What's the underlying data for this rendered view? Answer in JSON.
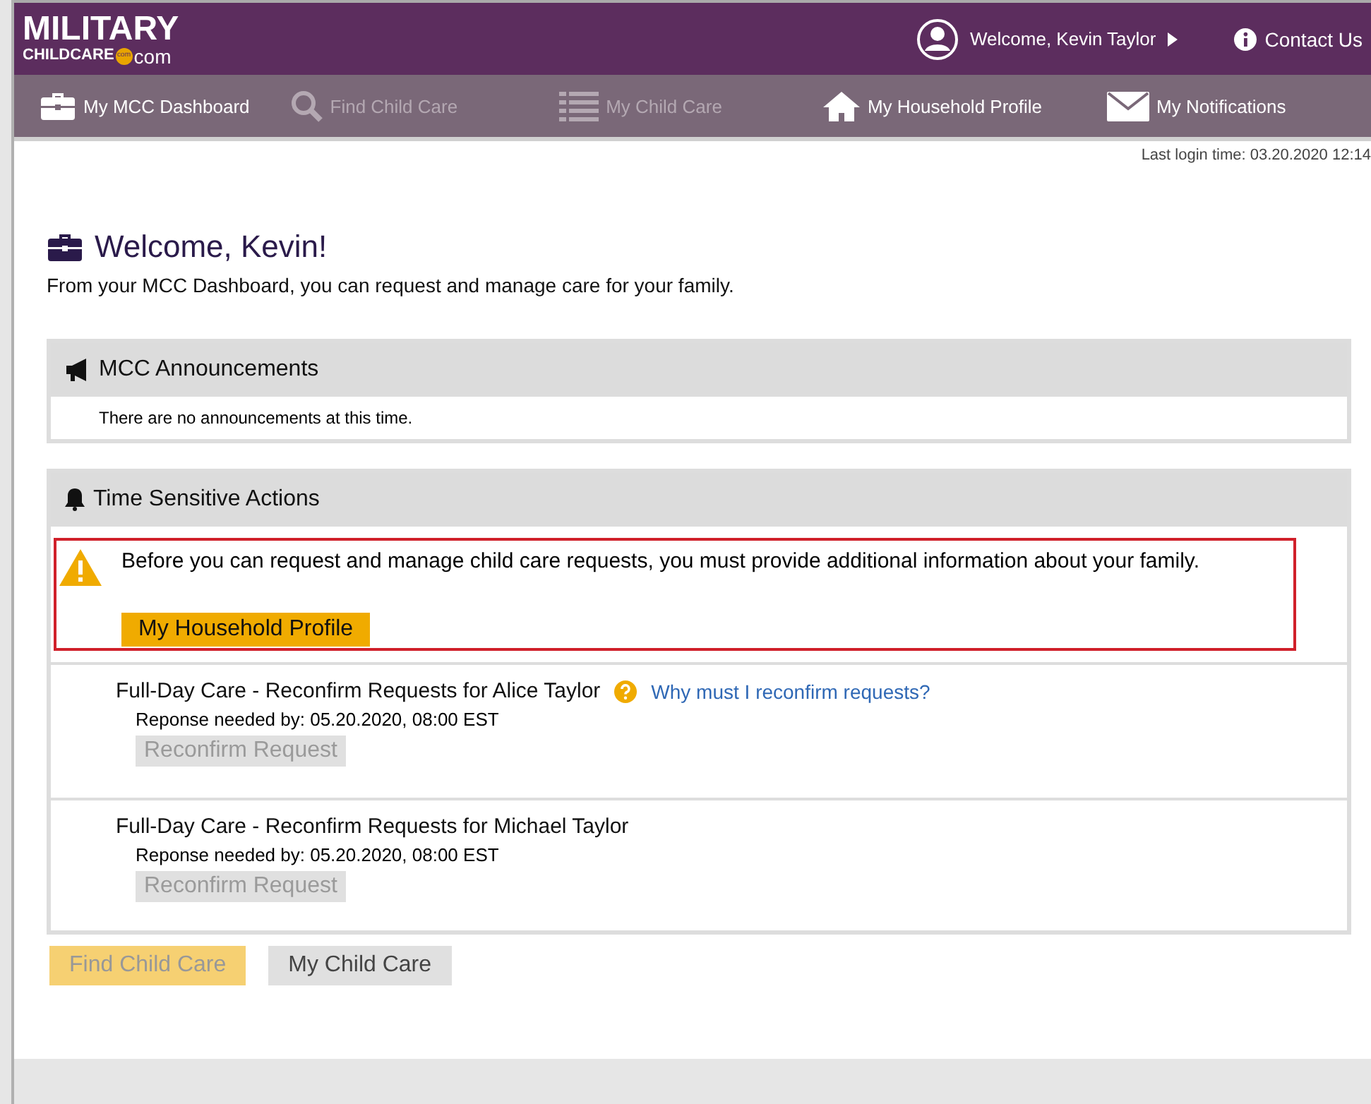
{
  "header": {
    "logo_top": "MILITARY",
    "logo_bottom": "CHILDCARE",
    "logo_badge": "com",
    "logo_suffix": "com",
    "user": "Welcome, Kevin Taylor",
    "contact": "Contact Us"
  },
  "nav": [
    {
      "label": "My MCC Dashboard",
      "kind": "briefcase",
      "disabled": false
    },
    {
      "label": "Find Child Care",
      "kind": "search",
      "disabled": true
    },
    {
      "label": "My Child Care",
      "kind": "list",
      "disabled": true
    },
    {
      "label": "My Household Profile",
      "kind": "home",
      "disabled": false
    },
    {
      "label": "My Notifications",
      "kind": "mail",
      "disabled": false
    }
  ],
  "last_login": "Last login time: 03.20.2020 12:14",
  "title": "Welcome, Kevin!",
  "intro": "From your MCC Dashboard, you can request and manage care for your family.",
  "announcements": {
    "title": "MCC Announcements",
    "message": "There are no announcements at this time."
  },
  "actions": {
    "title": "Time Sensitive Actions",
    "alert": {
      "message": "Before you can request and manage child care requests, you must provide additional information about your family.",
      "button": "My Household Profile"
    },
    "items": [
      {
        "title": "Full-Day Care  - Reconfirm Requests for Alice Taylor",
        "help_link": "Why must I reconfirm requests?",
        "deadline": "Reponse needed by: 05.20.2020, 08:00 EST",
        "button": "Reconfirm Request",
        "disabled": true
      },
      {
        "title": "Full-Day Care  - Reconfirm Requests for Michael Taylor",
        "deadline": "Reponse needed by: 05.20.2020, 08:00 EST",
        "button": "Reconfirm Request",
        "disabled": true
      }
    ]
  },
  "buttons": [
    {
      "label": "Find Child Care",
      "kind": "primary",
      "disabled": true
    },
    {
      "label": "My Child Care",
      "kind": "secondary",
      "disabled": false
    }
  ]
}
